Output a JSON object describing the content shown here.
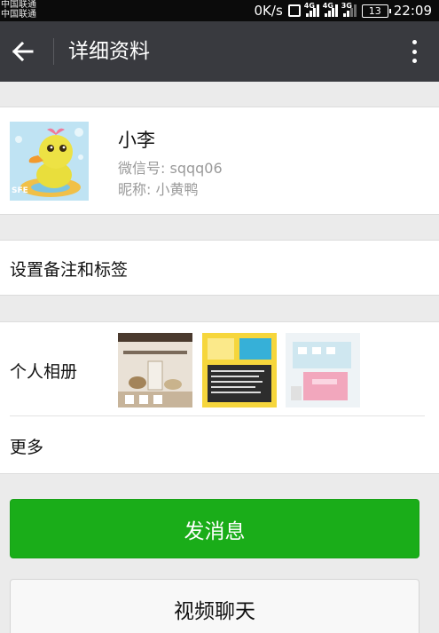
{
  "status_bar": {
    "carrier_1": "中国联通",
    "carrier_2": "中国联通",
    "speed": "0K/s",
    "network_1": "4G",
    "network_2": "4G",
    "network_3": "3G",
    "battery": "13",
    "time": "22:09"
  },
  "header": {
    "title": "详细资料"
  },
  "profile": {
    "name": "小李",
    "wechat_id": "微信号: sqqq06",
    "nickname": "昵称: 小黄鸭"
  },
  "rows": {
    "remark_label": "设置备注和标签",
    "album_label": "个人相册",
    "more_label": "更多"
  },
  "actions": {
    "send_message": "发消息",
    "video_call": "视频聊天"
  },
  "colors": {
    "accent_green": "#1aad19",
    "titlebar": "#393a3f"
  }
}
